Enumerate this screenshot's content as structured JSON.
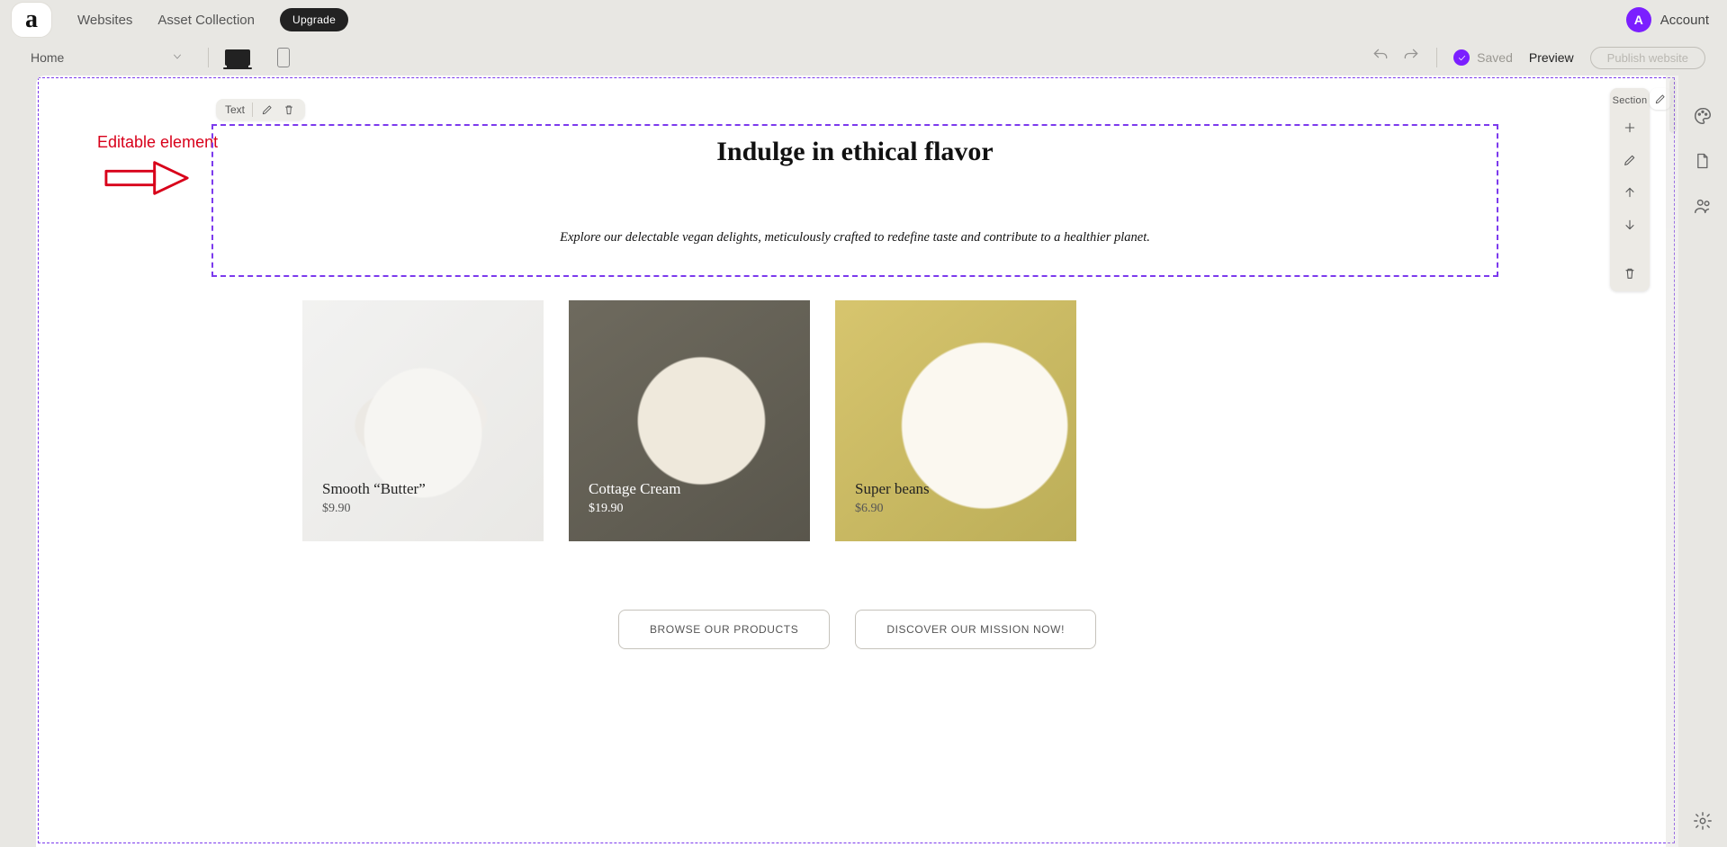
{
  "topnav": {
    "logo_letter": "a",
    "websites": "Websites",
    "asset_collection": "Asset Collection",
    "upgrade": "Upgrade",
    "account": "Account",
    "avatar_initial": "A"
  },
  "toolbar": {
    "page_name": "Home",
    "saved_label": "Saved",
    "preview": "Preview",
    "publish": "Publish website"
  },
  "annotation": {
    "label": "Editable element"
  },
  "floating_tools": {
    "label": "Text"
  },
  "section_panel": {
    "header": "Section"
  },
  "content": {
    "heading": "Indulge in ethical flavor",
    "subheading": "Explore our delectable vegan delights, meticulously crafted to redefine taste and contribute to a healthier planet."
  },
  "products": [
    {
      "name": "Smooth “Butter”",
      "price": "$9.90"
    },
    {
      "name": "Cottage Cream",
      "price": "$19.90"
    },
    {
      "name": "Super beans",
      "price": "$6.90"
    }
  ],
  "cta": {
    "browse": "BROWSE OUR PRODUCTS",
    "discover": "DISCOVER OUR MISSION NOW!"
  }
}
